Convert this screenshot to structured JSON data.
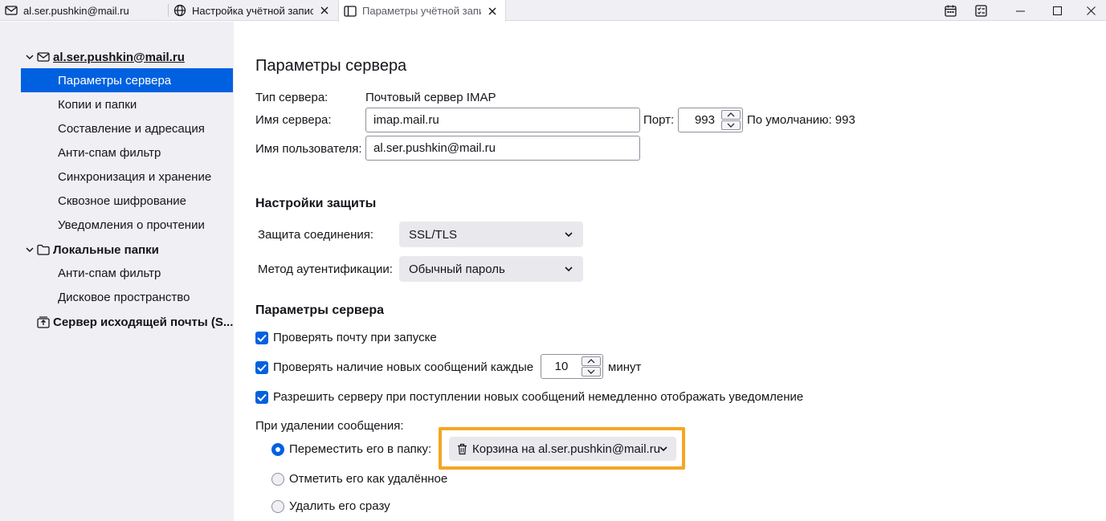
{
  "tabs": [
    {
      "label": "al.ser.pushkin@mail.ru",
      "icon": "mail-icon"
    },
    {
      "label": "Настройка учётной записи",
      "icon": "globe-icon"
    },
    {
      "label": "Параметры учётной записи",
      "icon": "settings-tab-icon"
    }
  ],
  "sidebar": {
    "account": "al.ser.pushkin@mail.ru",
    "account_items": [
      "Параметры сервера",
      "Копии и папки",
      "Составление и адресация",
      "Анти-спам фильтр",
      "Синхронизация и хранение",
      "Сквозное шифрование",
      "Уведомления о прочтении"
    ],
    "local_folders": "Локальные папки",
    "local_items": [
      "Анти-спам фильтр",
      "Дисковое пространство"
    ],
    "outgoing": "Сервер исходящей почты (S..."
  },
  "main": {
    "title": "Параметры сервера",
    "server_type_label": "Тип сервера:",
    "server_type_value": "Почтовый сервер IMAP",
    "server_name_label": "Имя сервера:",
    "server_name_value": "imap.mail.ru",
    "port_label": "Порт:",
    "port_value": "993",
    "port_default": "По умолчанию: 993",
    "username_label": "Имя пользователя:",
    "username_value": "al.ser.pushkin@mail.ru",
    "security_heading": "Настройки защиты",
    "conn_security_label": "Защита соединения:",
    "conn_security_value": "SSL/TLS",
    "auth_method_label": "Метод аутентификации:",
    "auth_method_value": "Обычный пароль",
    "server_settings_heading": "Параметры сервера",
    "check_on_startup": "Проверять почту при запуске",
    "check_every": "Проверять наличие новых сообщений каждые",
    "check_every_value": "10",
    "minutes": "минут",
    "allow_push": "Разрешить серверу при поступлении новых сообщений немедленно отображать уведомление",
    "on_delete_label": "При удалении сообщения:",
    "move_to_folder": "Переместить его в папку:",
    "trash_folder": "Корзина на al.ser.pushkin@mail.ru",
    "mark_deleted": "Отметить его как удалённое",
    "delete_immediately": "Удалить его сразу"
  },
  "colors": {
    "accent": "#0061e0",
    "highlight": "#f5a623",
    "sidebar_bg": "#f0f0f4"
  }
}
